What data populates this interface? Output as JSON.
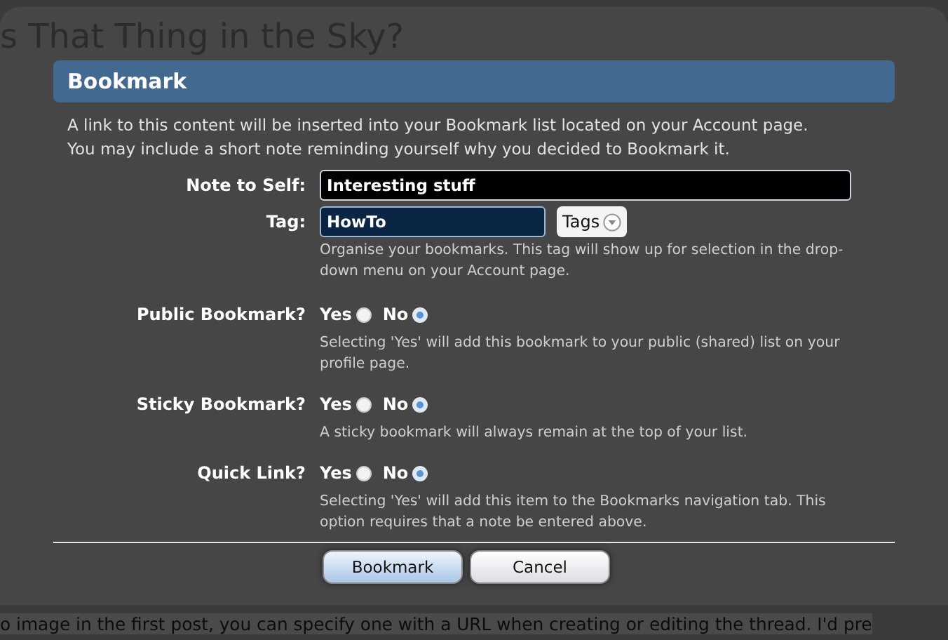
{
  "page_title": "s That Thing in the Sky?",
  "dialog": {
    "title": "Bookmark",
    "intro": "A link to this content will be inserted into your Bookmark list located on your Account page.\nYou may include a short note reminding yourself why you decided to Bookmark it.",
    "note": {
      "label": "Note to Self:",
      "value": "Interesting stuff"
    },
    "tag": {
      "label": "Tag:",
      "value": "HowTo",
      "button": "Tags",
      "hint": "Organise your bookmarks. This tag will show up for selection in the drop-down menu on your Account page."
    },
    "choices": [
      {
        "label": "Public Bookmark?",
        "options": [
          {
            "label": "Yes",
            "selected": false
          },
          {
            "label": "No",
            "selected": true
          }
        ],
        "hint": "Selecting 'Yes' will add this bookmark to your public (shared) list on your profile page."
      },
      {
        "label": "Sticky Bookmark?",
        "options": [
          {
            "label": "Yes",
            "selected": false
          },
          {
            "label": "No",
            "selected": true
          }
        ],
        "hint": "A sticky bookmark will always remain at the top of your list."
      },
      {
        "label": "Quick Link?",
        "options": [
          {
            "label": "Yes",
            "selected": false
          },
          {
            "label": "No",
            "selected": true
          }
        ],
        "hint": "Selecting 'Yes' will add this item to the Bookmarks navigation tab. This option requires that a note be entered above."
      }
    ],
    "buttons": [
      {
        "label": "Bookmark",
        "kind": "primary"
      },
      {
        "label": "Cancel",
        "kind": "secondary"
      }
    ]
  },
  "footer_text": "o image in the first post, you can specify one with a URL when creating or editing the thread. I'd pre"
}
